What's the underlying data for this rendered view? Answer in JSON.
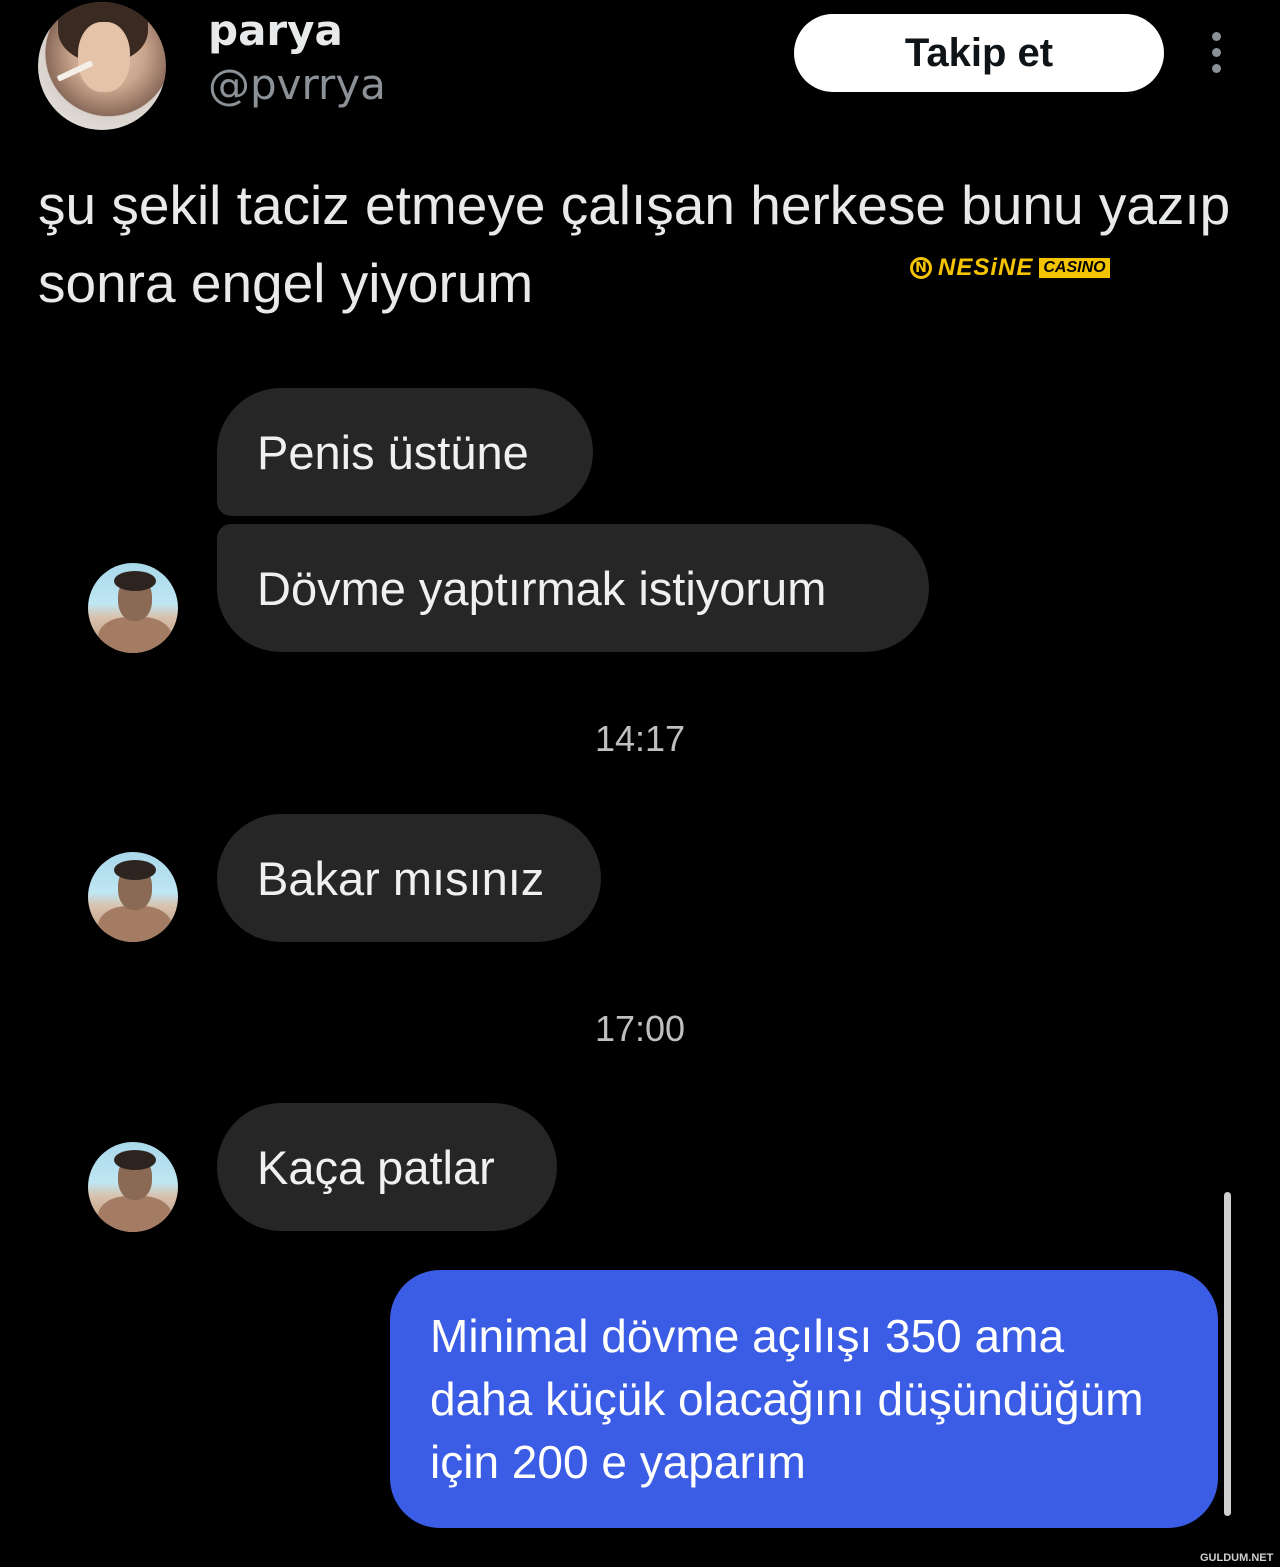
{
  "header": {
    "display_name": "parya",
    "handle": "@pvrrya",
    "follow_label": "Takip et"
  },
  "tweet": {
    "text": "şu şekil taciz etmeye çalışan herkese bunu yazıp sonra engel yiyorum"
  },
  "overlay_logo": {
    "brand": "NESiNE",
    "tag": "CASINO",
    "accent": "#f5c400"
  },
  "chat": {
    "incoming": [
      {
        "text": "Penis üstüne"
      },
      {
        "text": "Dövme yaptırmak istiyorum"
      },
      {
        "text": "Bakar mısınız"
      },
      {
        "text": "Kaça patlar"
      }
    ],
    "timestamps": [
      "14:17",
      "17:00"
    ],
    "outgoing": [
      {
        "text": "Minimal dövme açılışı 350 ama daha küçük olacağını düşündüğüm için 200 e yaparım"
      }
    ],
    "incoming_bubble_color": "#262626",
    "outgoing_bubble_color": "#3b5ce4"
  },
  "watermark": "GULDUM.NET"
}
